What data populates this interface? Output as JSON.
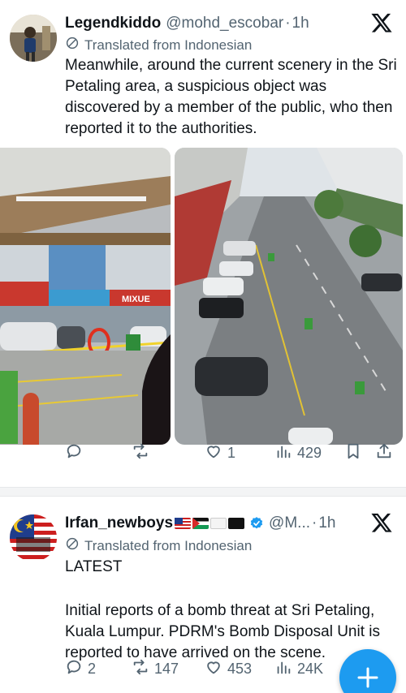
{
  "tweet1": {
    "display_name": "Legendkiddo",
    "handle": "@mohd_escobar",
    "separator": "·",
    "time": "1h",
    "translated_label": "Translated from Indonesian",
    "text": "Meanwhile, around the current scenery in the Sri Petaling area, a suspicious object was discovered by a member of the public, who then reported it to the authorities.",
    "actions": {
      "replies": "",
      "reposts": "",
      "likes": "1",
      "views": "429"
    },
    "media_left": {
      "shop_sign": "MIXUE",
      "store_sign": "MIXUE"
    }
  },
  "tweet2": {
    "display_name": "Irfan_newboys",
    "handle": "@M...",
    "separator": "·",
    "time": "1h",
    "translated_label": "Translated from Indonesian",
    "text_line1": "LATEST",
    "text_body": "Initial reports of a bomb threat at Sri Petaling, Kuala Lumpur. PDRM's Bomb Disposal Unit is reported to have arrived on the scene.",
    "actions": {
      "replies": "2",
      "reposts": "147",
      "likes": "453",
      "views": "24K"
    }
  },
  "colors": {
    "accent": "#1d9bf0",
    "muted": "#536471",
    "text": "#0f1419"
  },
  "icons": [
    "reply-icon",
    "repost-icon",
    "like-icon",
    "views-icon",
    "bookmark-icon",
    "share-icon",
    "x-logo-icon",
    "translate-icon",
    "verified-icon",
    "compose-plus-icon"
  ]
}
